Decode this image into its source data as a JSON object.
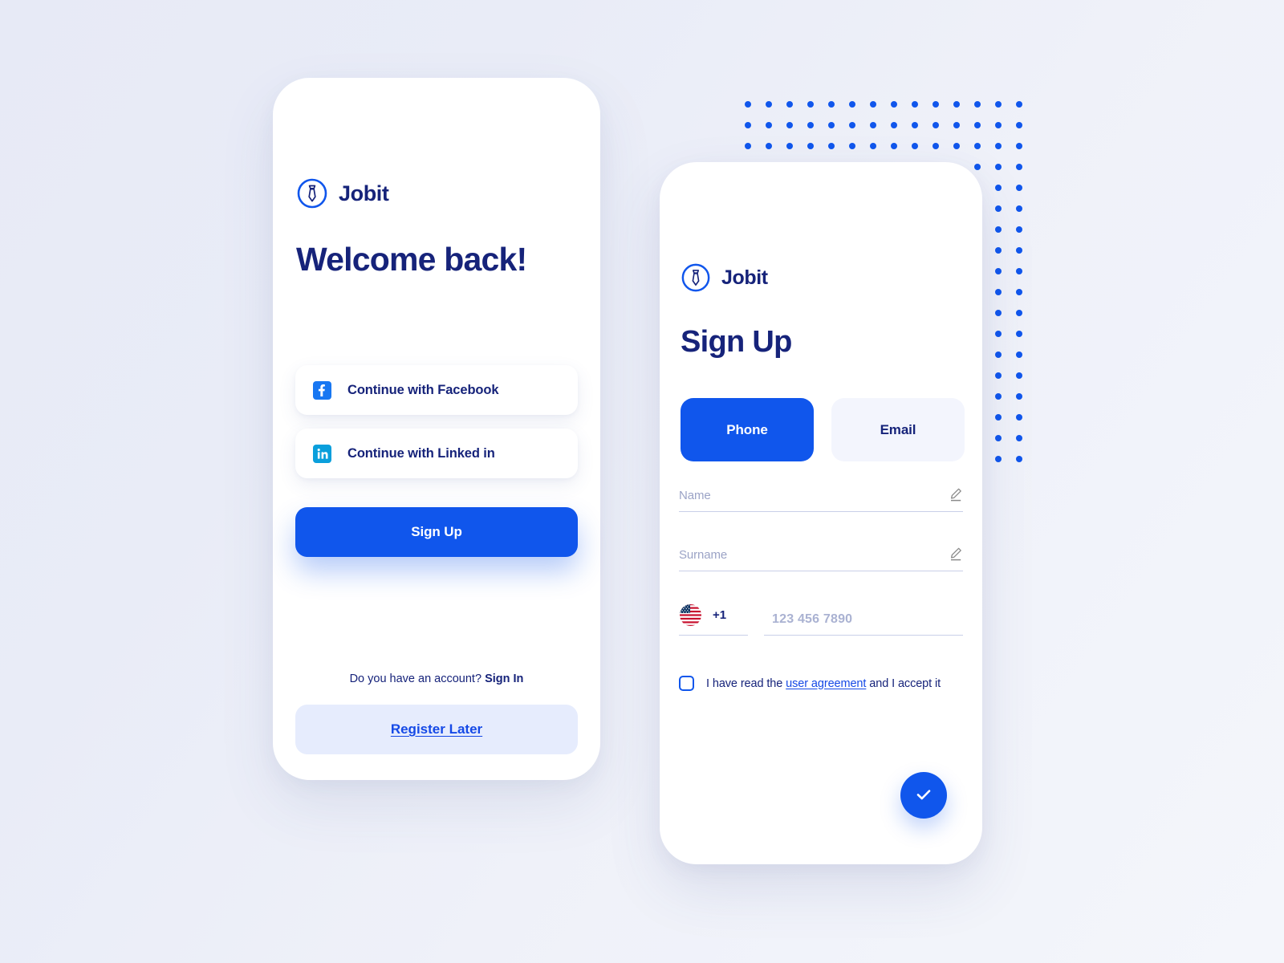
{
  "theme": {
    "brand_blue": "#1056ec",
    "navy": "#16237a",
    "link_blue": "#1549e6",
    "muted": "#9ba3c6",
    "soft_blue_bg": "#e6ecfd",
    "page_bg_start": "#e7eaf6",
    "page_bg_end": "#f4f6fb"
  },
  "background": {
    "dot_grid": {
      "name": "dot-grid-pattern",
      "columns": 14,
      "rows": 18,
      "dot_color": "#1056ec"
    }
  },
  "sign_in_screen": {
    "logo": {
      "icon": "necktie-circle-icon",
      "name": "Jobit"
    },
    "title": "Welcome back!",
    "social_buttons": [
      {
        "icon": "facebook-icon",
        "label": "Continue with Facebook"
      },
      {
        "icon": "linkedin-icon",
        "label": "Continue with Linked in"
      }
    ],
    "primary_button": "Sign Up",
    "account_prompt": "Do you have an account?",
    "sign_in_link": "Sign In",
    "register_later_button": "Register Later"
  },
  "sign_up_screen": {
    "logo": {
      "icon": "necktie-circle-icon",
      "name": "Jobit"
    },
    "title": "Sign Up",
    "segmented_control": {
      "selected": "Phone",
      "options": [
        "Phone",
        "Email"
      ]
    },
    "fields": [
      {
        "label": "Name",
        "value": "",
        "icon": "pencil-edit-icon"
      },
      {
        "label": "Surname",
        "value": "",
        "icon": "pencil-edit-icon"
      }
    ],
    "phone_field": {
      "flag": "us-flag-icon",
      "country_code": "+1",
      "placeholder": "123 456 7890",
      "value": ""
    },
    "agreement": {
      "checked": false,
      "text_before": "I have read the ",
      "link_text": "user agreement",
      "text_after": " and I accept it"
    },
    "confirm_button": {
      "icon": "check-icon",
      "label": ""
    }
  }
}
